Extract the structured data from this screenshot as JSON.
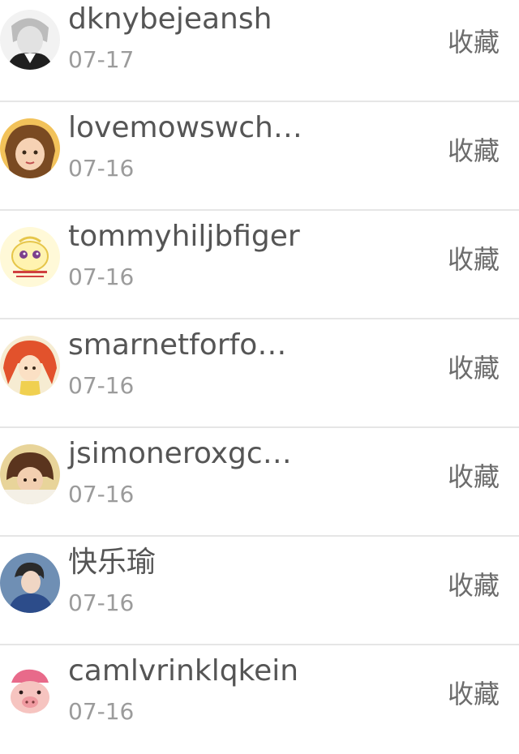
{
  "items": [
    {
      "name": "dknybejeansh",
      "date": "07-17",
      "action": "收藏"
    },
    {
      "name": "lovemowswch…",
      "date": "07-16",
      "action": "收藏"
    },
    {
      "name": "tommyhiljbfiger",
      "date": "07-16",
      "action": "收藏"
    },
    {
      "name": "smarnetforfo…",
      "date": "07-16",
      "action": "收藏"
    },
    {
      "name": "jsimoneroxgc…",
      "date": "07-16",
      "action": "收藏"
    },
    {
      "name": "快乐瑜",
      "date": "07-16",
      "action": "收藏"
    },
    {
      "name": "camlvrinklqkein",
      "date": "07-16",
      "action": "收藏"
    }
  ],
  "colors": {
    "name": "#555555",
    "date": "#9b9b9b",
    "action": "#6c6c6c",
    "divider": "#e6e6e6"
  }
}
